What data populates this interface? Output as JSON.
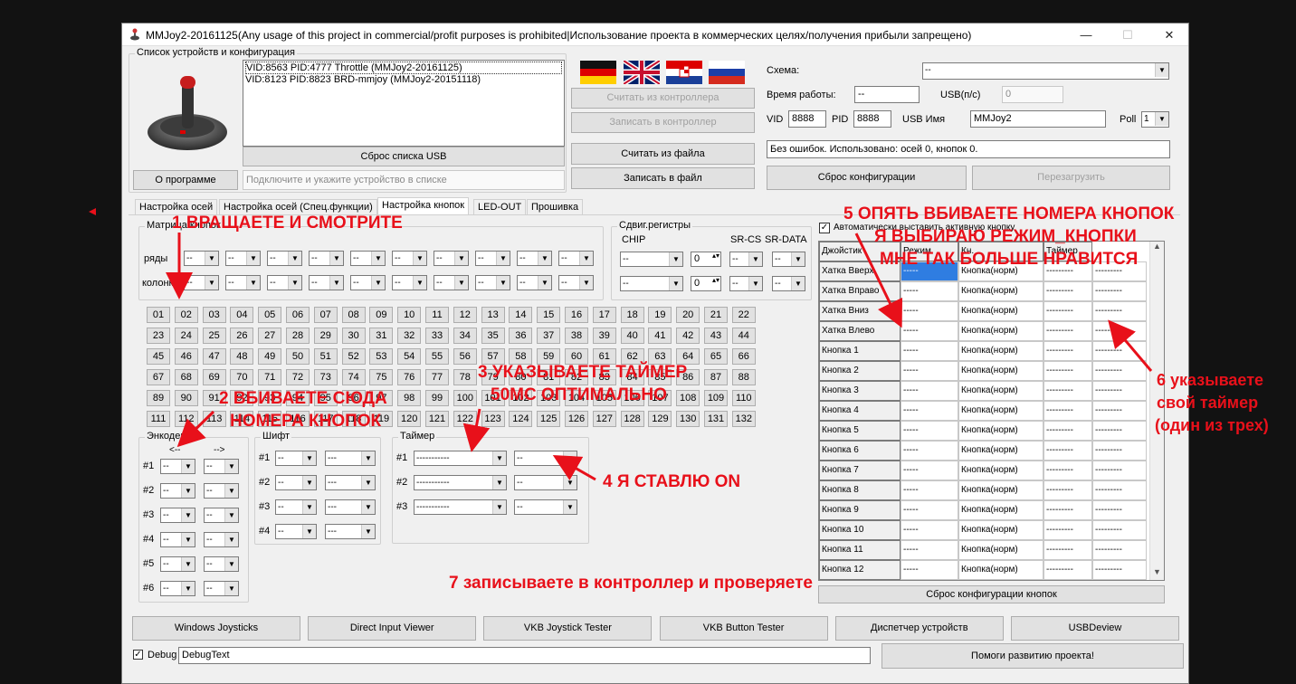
{
  "window": {
    "title": "MMJoy2-20161125(Any usage of this project in commercial/profit purposes is prohibited|Использование проекта в коммерческих целях/получения прибыли запрещено)",
    "controls": [
      "—",
      "☐",
      "✕"
    ]
  },
  "devices": {
    "group_title": "Список устройств и конфигурация",
    "list": [
      "VID:8563 PID:4777 Throttle (MMJoy2-20161125)",
      "VID:8123 PID:8823 BRD-mmjoy (MMJoy2-20151118)"
    ],
    "reset_usb": "Сброс списка USB",
    "about": "О программе",
    "hint": "Подключите и укажите устройство в списке"
  },
  "controller_buttons": {
    "read_controller": "Считать из контроллера",
    "write_controller": "Записать в контроллер",
    "read_file": "Считать из файла",
    "write_file": "Записать в файл"
  },
  "config": {
    "scheme_label": "Схема:",
    "scheme_value": "--",
    "uptime_label": "Время работы:",
    "uptime_value": "--",
    "usb_label": "USB(п/с)",
    "usb_value": "0",
    "vid_label": "VID",
    "vid_value": "8888",
    "pid_label": "PID",
    "pid_value": "8888",
    "usb_name_label": "USB Имя",
    "usb_name_value": "MMJoy2",
    "poll_label": "Poll",
    "poll_value": "1",
    "status": "Без ошибок. Использовано: осей  0, кнопок  0.",
    "reset_config": "Сброс конфигурации",
    "reboot": "Перезагрузить"
  },
  "tabs": [
    "Настройка осей",
    "Настройка осей (Спец.функции)",
    "Настройка кнопок",
    "LED-OUT",
    "Прошивка"
  ],
  "matrix": {
    "title": "Матрица кнопок",
    "rows_label": "ряды",
    "cols_label": "колонки",
    "value": "--"
  },
  "shift_regs": {
    "title": "Сдвиг.регистры",
    "chip": "CHIP",
    "sr_cs": "SR-CS",
    "sr_data": "SR-DATA",
    "value": "--",
    "spin": "0"
  },
  "button_numbers": [
    "01",
    "02",
    "03",
    "04",
    "05",
    "06",
    "07",
    "08",
    "09",
    "10",
    "11",
    "12",
    "13",
    "14",
    "15",
    "16",
    "17",
    "18",
    "19",
    "20",
    "21",
    "22",
    "23",
    "24",
    "25",
    "26",
    "27",
    "28",
    "29",
    "30",
    "31",
    "32",
    "33",
    "34",
    "35",
    "36",
    "37",
    "38",
    "39",
    "40",
    "41",
    "42",
    "43",
    "44",
    "45",
    "46",
    "47",
    "48",
    "49",
    "50",
    "51",
    "52",
    "53",
    "54",
    "55",
    "56",
    "57",
    "58",
    "59",
    "60",
    "61",
    "62",
    "63",
    "64",
    "65",
    "66",
    "67",
    "68",
    "69",
    "70",
    "71",
    "72",
    "73",
    "74",
    "75",
    "76",
    "77",
    "78",
    "79",
    "80",
    "81",
    "82",
    "83",
    "84",
    "85",
    "86",
    "87",
    "88",
    "89",
    "90",
    "91",
    "92",
    "93",
    "94",
    "95",
    "96",
    "97",
    "98",
    "99",
    "100",
    "101",
    "102",
    "103",
    "104",
    "105",
    "106",
    "107",
    "108",
    "109",
    "110",
    "111",
    "112",
    "113",
    "114",
    "115",
    "116",
    "117",
    "118",
    "119",
    "120",
    "121",
    "122",
    "123",
    "124",
    "125",
    "126",
    "127",
    "128",
    "129",
    "130",
    "131",
    "132"
  ],
  "encoders": {
    "title": "Энкодеры:",
    "left_arrow": "<--",
    "right_arrow": "-->",
    "rows": [
      "#1",
      "#2",
      "#3",
      "#4",
      "#5",
      "#6"
    ],
    "value": "--"
  },
  "shift": {
    "title": "Шифт",
    "rows": [
      "#1",
      "#2",
      "#3",
      "#4"
    ],
    "value": "--",
    "value2": "---"
  },
  "timer": {
    "title": "Таймер",
    "rows": [
      "#1",
      "#2",
      "#3"
    ],
    "value": "-----------",
    "value2": "--"
  },
  "right_panel": {
    "auto_label": "Автоматически выставить активную кнопку",
    "columns": [
      "Джойстик",
      "Режим",
      "Кн.",
      "Таймер"
    ],
    "rows": [
      [
        "Хатка Вверх",
        "-----",
        "Кнопка(норм)",
        "---------",
        "---------"
      ],
      [
        "Хатка Вправо",
        "-----",
        "Кнопка(норм)",
        "---------",
        "---------"
      ],
      [
        "Хатка Вниз",
        "-----",
        "Кнопка(норм)",
        "---------",
        "---------"
      ],
      [
        "Хатка Влево",
        "-----",
        "Кнопка(норм)",
        "---------",
        "---------"
      ],
      [
        "Кнопка 1",
        "-----",
        "Кнопка(норм)",
        "---------",
        "---------"
      ],
      [
        "Кнопка 2",
        "-----",
        "Кнопка(норм)",
        "---------",
        "---------"
      ],
      [
        "Кнопка 3",
        "-----",
        "Кнопка(норм)",
        "---------",
        "---------"
      ],
      [
        "Кнопка 4",
        "-----",
        "Кнопка(норм)",
        "---------",
        "---------"
      ],
      [
        "Кнопка 5",
        "-----",
        "Кнопка(норм)",
        "---------",
        "---------"
      ],
      [
        "Кнопка 6",
        "-----",
        "Кнопка(норм)",
        "---------",
        "---------"
      ],
      [
        "Кнопка 7",
        "-----",
        "Кнопка(норм)",
        "---------",
        "---------"
      ],
      [
        "Кнопка 8",
        "-----",
        "Кнопка(норм)",
        "---------",
        "---------"
      ],
      [
        "Кнопка 9",
        "-----",
        "Кнопка(норм)",
        "---------",
        "---------"
      ],
      [
        "Кнопка 10",
        "-----",
        "Кнопка(норм)",
        "---------",
        "---------"
      ],
      [
        "Кнопка 11",
        "-----",
        "Кнопка(норм)",
        "---------",
        "---------"
      ],
      [
        "Кнопка 12",
        "-----",
        "Кнопка(норм)",
        "---------",
        "---------"
      ]
    ],
    "reset_buttons": "Сброс конфигурации кнопок"
  },
  "bottom_buttons": [
    "Windows Joysticks",
    "Direct Input Viewer",
    "VKB Joystick Tester",
    "VKB Button Tester",
    "Диспетчер устройств",
    "USBDeview"
  ],
  "debug": {
    "label": "Debug",
    "value": "DebugText",
    "help": "Помоги развитию проекта!"
  },
  "annotations": {
    "a1": "1 ВРАЩАЕТЕ И СМОТРИТЕ",
    "a2_line1": "2 ВБИВАЕТЕ СЮДА",
    "a2_line2": "НОМЕРА КНОПОК",
    "a3_line1": "3 УКАЗЫВАЕТЕ ТАЙМЕР",
    "a3_line2": "50МС ОПТИМАЛЬНО",
    "a4": "4 Я СТАВЛЮ ON",
    "a5_line1": "5 ОПЯТЬ ВБИВАЕТЕ НОМЕРА КНОПОК",
    "a5_line2": "Я ВЫБИРАЮ РЕЖИМ_КНОПКИ",
    "a5_line3": "МНЕ ТАК БОЛЬШЕ НРАВИТСЯ",
    "a6_line1": "6 указываете",
    "a6_line2": "свой таймер",
    "a6_line3": "(один из трех)",
    "a7": "7 записываете в контроллер и проверяете"
  },
  "colors": {
    "annotation": "#e8101a",
    "selection": "#2f7de1",
    "background": "#121212"
  }
}
